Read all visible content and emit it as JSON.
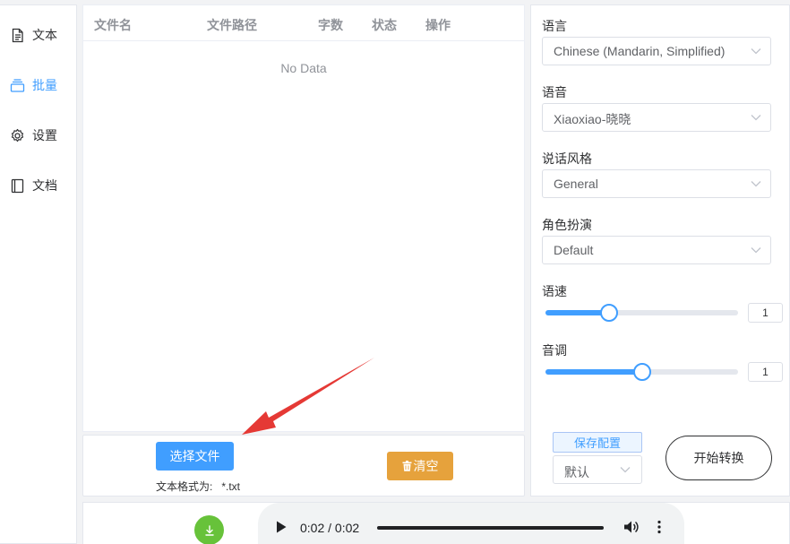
{
  "sidebar": {
    "items": [
      {
        "label": "文本",
        "icon": "document-icon",
        "active": false
      },
      {
        "label": "批量",
        "icon": "layers-icon",
        "active": true
      },
      {
        "label": "设置",
        "icon": "gear-icon",
        "active": false
      },
      {
        "label": "文档",
        "icon": "notebook-icon",
        "active": false
      }
    ]
  },
  "table": {
    "headers": [
      "文件名",
      "文件路径",
      "字数",
      "状态",
      "操作"
    ],
    "empty_text": "No Data"
  },
  "file_panel": {
    "choose_label": "选择文件",
    "format_label": "文本格式为:",
    "format_value": "*.txt",
    "clear_label": "清空"
  },
  "player": {
    "time": "0:02 / 0:02",
    "progress": 1.0
  },
  "settings": {
    "language_label": "语言",
    "language_value": "Chinese (Mandarin, Simplified)",
    "voice_label": "语音",
    "voice_value": "Xiaoxiao-晓晓",
    "style_label": "说话风格",
    "style_value": "General",
    "role_label": "角色扮演",
    "role_value": "Default",
    "speed_label": "语速",
    "speed_value": "1",
    "speed_level": 0.33,
    "pitch_label": "音调",
    "pitch_value": "1",
    "pitch_level": 0.5,
    "save_config_label": "保存配置",
    "preset_value": "默认",
    "start_label": "开始转换"
  },
  "colors": {
    "primary": "#409eff",
    "warning": "#e6a23c",
    "success": "#67c23a",
    "annotation_arrow": "#e53935"
  }
}
